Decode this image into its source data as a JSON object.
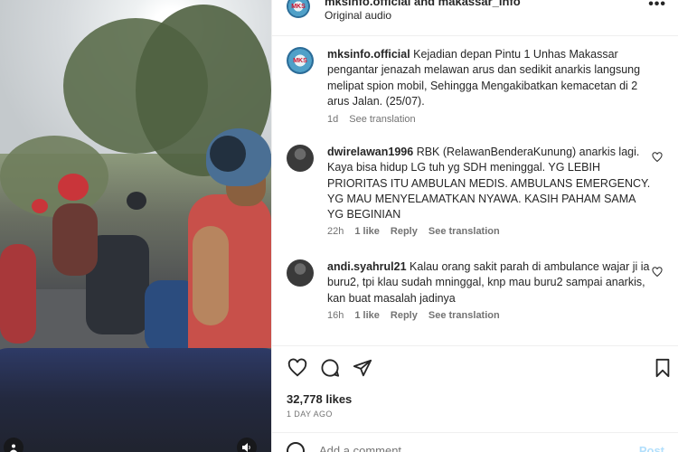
{
  "header": {
    "username": "mksinfo.official and makassar_info",
    "audio": "Original audio",
    "avatar_text": "MKS"
  },
  "caption": {
    "username": "mksinfo.official",
    "text": "Kejadian depan Pintu 1 Unhas Makassar pengantar jenazah melawan arus dan sedikit anarkis langsung melipat spion mobil, Sehingga Mengakibatkan kemacetan di 2 arus Jalan. (25/07).",
    "time": "1d",
    "see_translation": "See translation"
  },
  "comments": [
    {
      "username": "dwirelawan1996",
      "text": "RBK (RelawanBenderaKunung) anarkis lagi. Kaya bisa hidup LG tuh yg SDH meninggal. YG LEBIH PRIORITAS ITU AMBULAN MEDIS. AMBULANS EMERGENCY. YG MAU MENYELAMATKAN NYAWA. KASIH PAHAM SAMA YG BEGINIAN",
      "time": "22h",
      "likes": "1 like",
      "reply": "Reply",
      "see_translation": "See translation"
    },
    {
      "username": "andi.syahrul21",
      "text": "Kalau orang sakit parah di ambulance wajar ji ia buru2, tpi klau sudah mninggal, knp mau buru2 sampai anarkis, kan buat masalah jadinya",
      "time": "16h",
      "likes": "1 like",
      "reply": "Reply",
      "see_translation": "See translation"
    }
  ],
  "stats": {
    "likes": "32,778 likes",
    "date": "1 DAY AGO"
  },
  "add_comment": {
    "placeholder": "Add a comment…",
    "post": "Post"
  },
  "icons": [
    "heart-icon",
    "comment-icon",
    "share-icon",
    "bookmark-icon",
    "more-icon",
    "emoji-icon",
    "mute-icon",
    "user-tag-icon"
  ]
}
